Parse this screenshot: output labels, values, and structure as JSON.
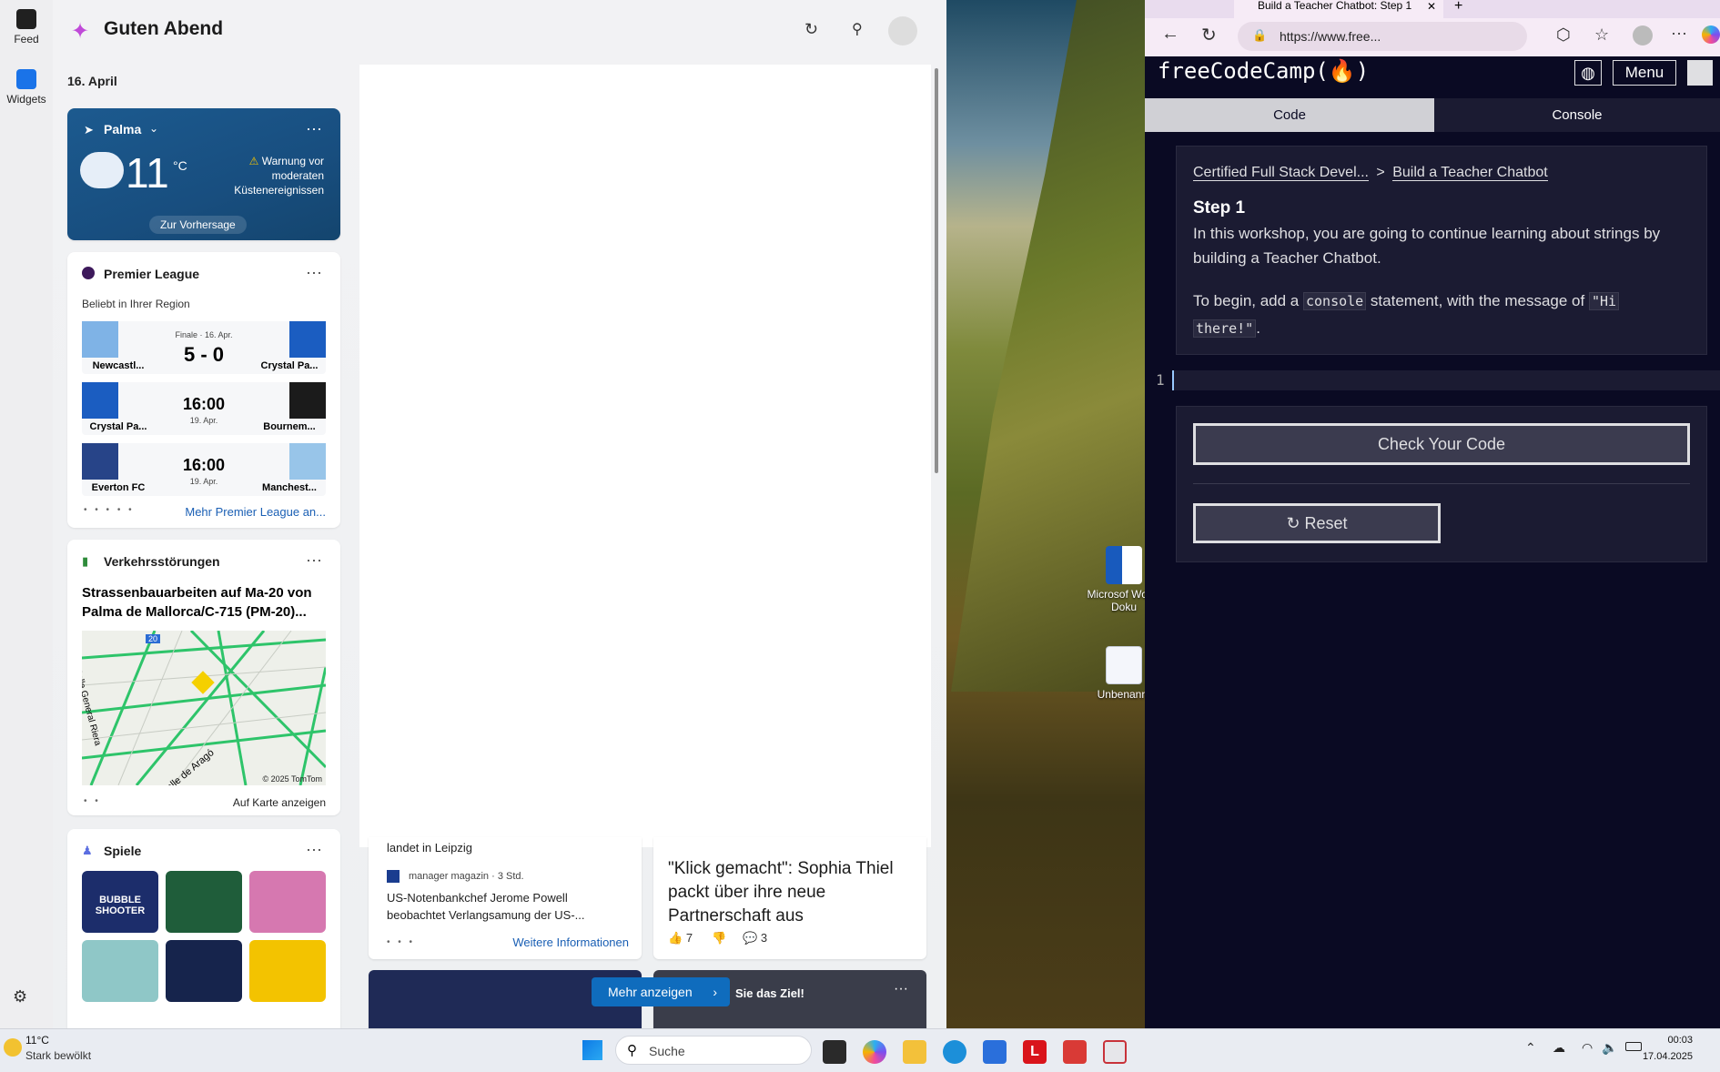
{
  "widgets": {
    "rail": [
      {
        "label": "Feed",
        "icon": "feed-icon"
      },
      {
        "label": "Widgets",
        "icon": "widgets-icon"
      }
    ],
    "greeting": "Guten Abend",
    "date": "16. April",
    "weather": {
      "location": "Palma",
      "temp": "11",
      "unit": "°C",
      "warning": "Warnung vor moderaten Küstenereignissen",
      "forecast_link": "Zur Vorhersage"
    },
    "league": {
      "title": "Premier League",
      "subtitle": "Beliebt in Ihrer Region",
      "matches": [
        {
          "home": "Newcastl...",
          "away": "Crystal Pa...",
          "status": "Finale · 16. Apr.",
          "score": "5 - 0",
          "date": ""
        },
        {
          "home": "Crystal Pa...",
          "away": "Bournem...",
          "status": "",
          "score": "16:00",
          "date": "19. Apr."
        },
        {
          "home": "Everton FC",
          "away": "Manchest...",
          "status": "",
          "score": "16:00",
          "date": "19. Apr."
        }
      ],
      "more": "Mehr Premier League an..."
    },
    "traffic": {
      "title": "Verkehrsstörungen",
      "headline": "Strassenbauarbeiten auf Ma-20 von Palma de Mallorca/C-715 (PM-20)...",
      "map_credit": "© 2025 TomTom",
      "street1": "Calle General Riera",
      "street2": "Calle de Aragó",
      "road_label": "20",
      "map_link": "Auf Karte anzeigen"
    },
    "games": {
      "title": "Spiele",
      "tile1": "BUBBLE SHOOTER"
    },
    "news": {
      "item1_partial": "landet in Leipzig",
      "item1_source": "manager magazin · 3 Std.",
      "item1_title": "US-Notenbankchef Jerome Powell beobachtet Verlangsamung der US-...",
      "item1_more": "Weitere Informationen",
      "item2_headline": "\"Klick gemacht\": Sophia Thiel packt über ihre neue Partnerschaft aus",
      "item2_likes": "7",
      "item2_comments": "3",
      "show_more": "Mehr anzeigen",
      "card_partial": "Sie das Ziel!"
    }
  },
  "desktop_icons": [
    {
      "label": "Microsof Word-Doku",
      "icon": "word-document-icon"
    },
    {
      "label": "Unbenannt",
      "icon": "spreadsheet-icon"
    }
  ],
  "browser": {
    "tab_title": "Build a Teacher Chatbot: Step 1",
    "url": "https://www.free...",
    "fcc": {
      "logo": "freeCodeCamp",
      "logo_flame": "(🔥)",
      "menu": "Menu",
      "tabs": [
        "Code",
        "Console"
      ],
      "breadcrumb1": "Certified Full Stack Devel...",
      "breadcrumb_sep": ">",
      "breadcrumb2": "Build a Teacher Chatbot",
      "step": "Step 1",
      "para1": "In this workshop, you are going to continue learning about strings by building a Teacher Chatbot.",
      "para2_pre": "To begin, add a ",
      "para2_code1": "console",
      "para2_mid": " statement, with the message of ",
      "para2_code2a": "\"Hi",
      "para2_code2b": "there!\"",
      "para2_post": ".",
      "line_no": "1",
      "check_btn": "Check Your Code",
      "reset_btn": "Reset"
    }
  },
  "taskbar": {
    "weather_temp": "11°C",
    "weather_desc": "Stark bewölkt",
    "search": "Suche",
    "time": "00:03",
    "date": "17.04.2025"
  },
  "colors": {
    "fcc_bg": "#0a0a23",
    "fcc_panel": "#1b1b32",
    "weather_card": "#1c5a8f",
    "link_blue": "#1a5fb4",
    "show_more_btn": "#0f6cbd"
  }
}
